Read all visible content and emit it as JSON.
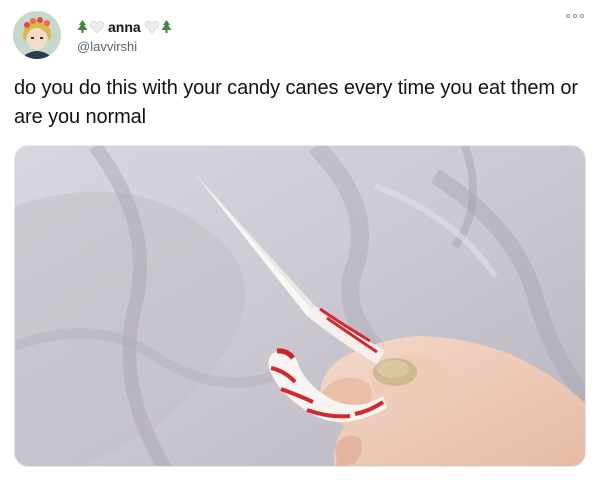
{
  "tweet": {
    "author": {
      "display_name": "anna",
      "handle": "@lavvirshi",
      "name_emojis": [
        "tree-emoji",
        "white-heart-emoji",
        "white-heart-emoji",
        "tree-emoji"
      ]
    },
    "text": "do you do this with your candy canes every time you eat them or are you normal",
    "media": {
      "description_icon": "photo-candy-cane"
    }
  },
  "colors": {
    "text": "#0f1419",
    "secondary": "#536471",
    "border": "#e1e8ed"
  }
}
